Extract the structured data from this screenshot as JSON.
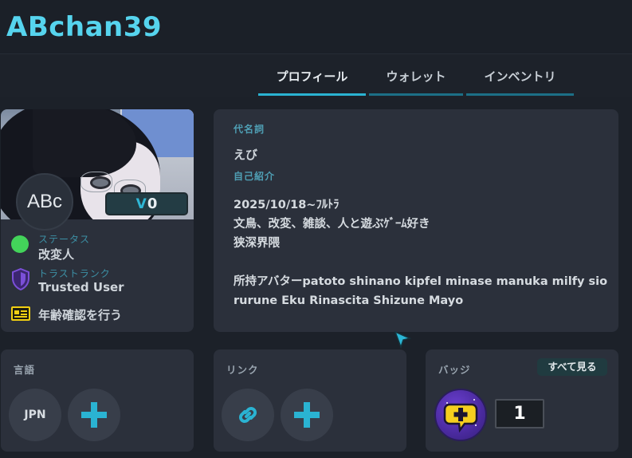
{
  "header": {
    "username": "ABchan39"
  },
  "tabs": [
    {
      "label": "プロフィール",
      "active": true
    },
    {
      "label": "ウォレット",
      "active": false
    },
    {
      "label": "インベントリ",
      "active": false
    }
  ],
  "avatar": {
    "initials": "ABc",
    "balance": "0",
    "currency_symbol": "V"
  },
  "status": {
    "label": "ステータス",
    "value": "改変人",
    "color": "#43d35a"
  },
  "trust": {
    "label": "トラストランク",
    "value": "Trusted User",
    "color": "#7b4fd8"
  },
  "age_verify": {
    "label": "年齢確認を行う"
  },
  "bio": {
    "pronoun_label": "代名詞",
    "pronoun_value": "えび",
    "intro_label": "自己紹介",
    "intro_text": "2025/10/18~ﾌﾙﾄﾗ\n文鳥、改変、雑談、人と遊ぶｹﾞｰﾑ好き\n狭深界隈\n\n所持アバターpatoto shinano kipfel minase manuka milfy sio rurune Eku Rinascita Shizune Mayo"
  },
  "languages": {
    "title": "言語",
    "items": [
      "JPN"
    ]
  },
  "links": {
    "title": "リンク"
  },
  "badges": {
    "title": "バッジ",
    "see_all": "すべて見る",
    "count": "1"
  },
  "colors": {
    "accent": "#2ab3d2",
    "username": "#56d4ee",
    "card": "#2b303b",
    "background": "#1c2129"
  }
}
